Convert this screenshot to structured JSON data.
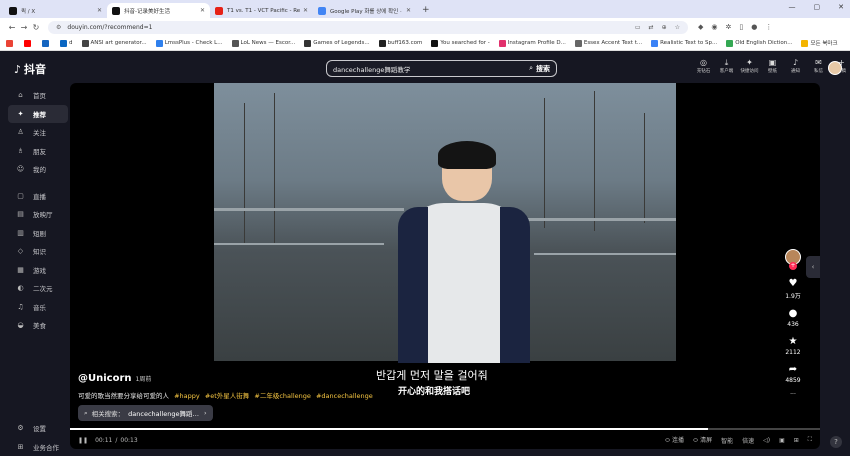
{
  "tabs": [
    {
      "title": "퀵 / X",
      "active": false,
      "color": "#111111"
    },
    {
      "title": "抖音-记录美好生活",
      "active": true,
      "color": "#111111"
    },
    {
      "title": "T1 vs. T1 - VCT Pacific - Requ",
      "active": false,
      "color": "#e62117"
    },
    {
      "title": "Google Play 화를 상에 확인 ·",
      "active": false,
      "color": "#4285f4"
    }
  ],
  "address": {
    "url": "douyin.com/?recommend=1"
  },
  "bookmarks": [
    {
      "label": "",
      "color": "#ea4335"
    },
    {
      "label": "",
      "color": "#ff0000"
    },
    {
      "label": "",
      "color": "#1565c0"
    },
    {
      "label": "d",
      "color": "#0a66c2"
    },
    {
      "label": "ANSI art generator...",
      "color": "#444444"
    },
    {
      "label": "LmssPlus - Check L...",
      "color": "#2f80ed"
    },
    {
      "label": "LoL News — Escor...",
      "color": "#555555"
    },
    {
      "label": "Games of Legends...",
      "color": "#333333"
    },
    {
      "label": "buff163.com",
      "color": "#222222"
    },
    {
      "label": "You searched for -",
      "color": "#111111"
    },
    {
      "label": "Instagram Profile D...",
      "color": "#e1306c"
    },
    {
      "label": "Essex Accent Text t...",
      "color": "#666666"
    },
    {
      "label": "Realistic Text to Sp...",
      "color": "#3b82f6"
    },
    {
      "label": "Old English Diction...",
      "color": "#34a853"
    },
    {
      "label": "모든 북마크",
      "color": "#f4b400"
    }
  ],
  "app": {
    "logo": "抖音",
    "search_query": "dancechallenge舞蹈教学",
    "search_button": "搜索",
    "top_icons": [
      {
        "label": "充钻石",
        "glyph": "◎"
      },
      {
        "label": "客户端",
        "glyph": "⤓"
      },
      {
        "label": "快捷访问",
        "glyph": "✦"
      },
      {
        "label": "壁纸",
        "glyph": "▣"
      },
      {
        "label": "通知",
        "glyph": "♪"
      },
      {
        "label": "私信",
        "glyph": "✉"
      },
      {
        "label": "投稿",
        "glyph": "+"
      }
    ],
    "sidebar": [
      {
        "label": "首页",
        "glyph": "⌂",
        "active": false
      },
      {
        "label": "推荐",
        "glyph": "✦",
        "active": true
      },
      {
        "label": "关注",
        "glyph": "♙",
        "active": false
      },
      {
        "label": "朋友",
        "glyph": "♗",
        "active": false
      },
      {
        "label": "我的",
        "glyph": "☺",
        "active": false
      },
      {
        "label": "直播",
        "glyph": "▢",
        "active": false
      },
      {
        "label": "放映厅",
        "glyph": "▤",
        "active": false
      },
      {
        "label": "短剧",
        "glyph": "▥",
        "active": false
      },
      {
        "label": "知识",
        "glyph": "◇",
        "active": false
      },
      {
        "label": "游戏",
        "glyph": "▦",
        "active": false
      },
      {
        "label": "二次元",
        "glyph": "◐",
        "active": false
      },
      {
        "label": "音乐",
        "glyph": "♫",
        "active": false
      },
      {
        "label": "美食",
        "glyph": "◒",
        "active": false
      }
    ],
    "sidebar_bottom": [
      {
        "label": "设置",
        "glyph": "⚙"
      },
      {
        "label": "业务合作",
        "glyph": "⊞"
      }
    ]
  },
  "video": {
    "subtitle_ko": "반갑게 먼저 말을 걸어줘",
    "subtitle_zh": "开心的和我搭话吧",
    "author": "@Unicorn",
    "posted": "1周前",
    "description": "可爱的歌当然要分享给可爱的人",
    "hashtags": [
      "#happy",
      "#et外星人街舞",
      "#二年级challenge",
      "#dancechallenge"
    ],
    "related_label": "相关搜索：",
    "related_query": "dancechallenge舞蹈…",
    "likes": "1.9万",
    "comments": "436",
    "favorites": "2112",
    "shares": "4859",
    "more": "···",
    "current_time": "00:11",
    "duration": "00:13",
    "progress": 0.85,
    "controls": [
      "连播",
      "清屏",
      "智能",
      "倍速"
    ]
  }
}
